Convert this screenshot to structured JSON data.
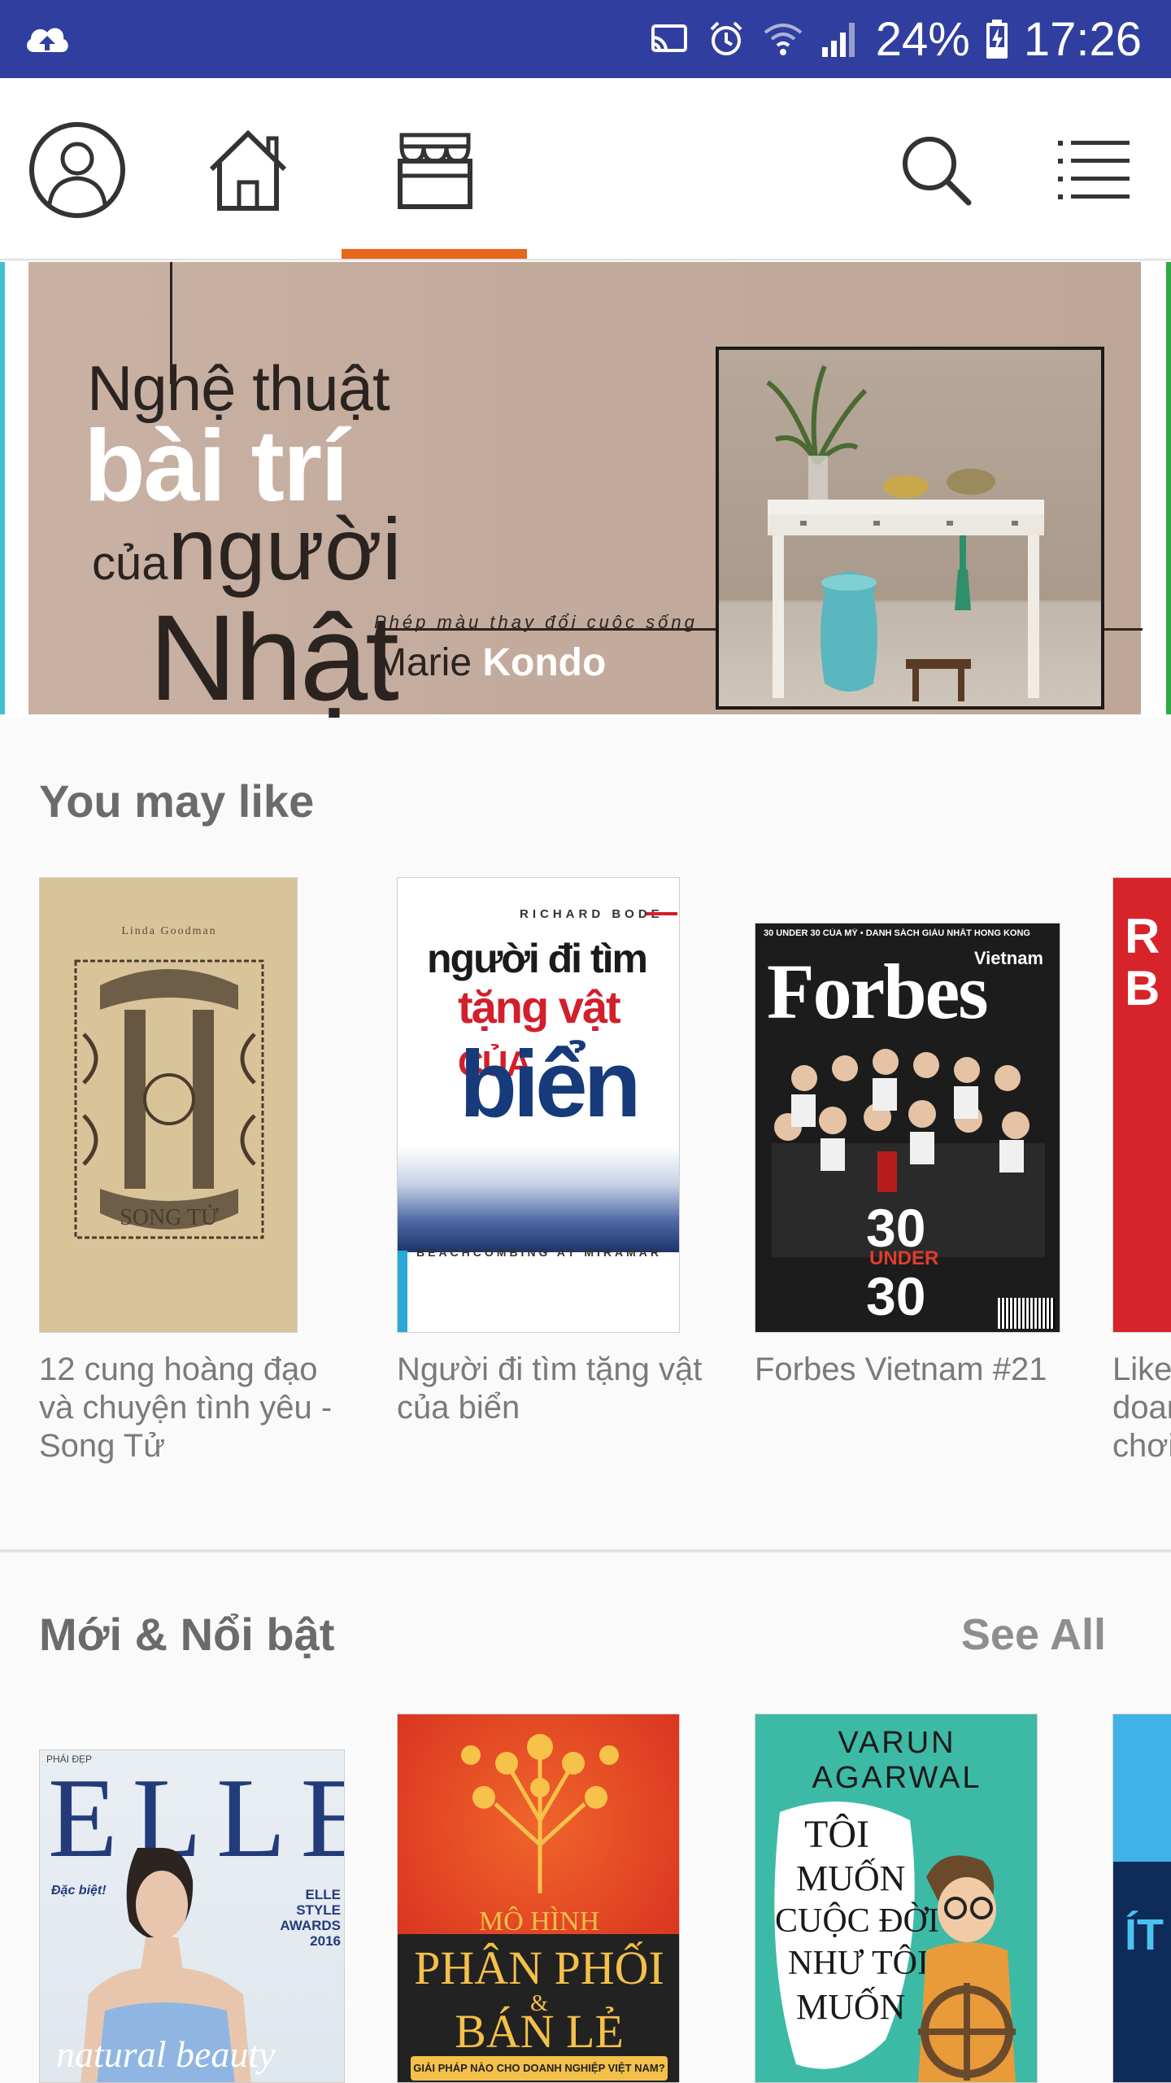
{
  "status_bar": {
    "battery": "24%",
    "time": "17:26",
    "icons": [
      "cloud-upload-icon",
      "cast-icon",
      "alarm-icon",
      "wifi-icon",
      "signal-icon",
      "battery-charging-icon"
    ]
  },
  "nav": {
    "items": [
      "profile-icon",
      "home-icon",
      "store-icon",
      "search-icon",
      "menu-icon"
    ],
    "active": "store",
    "accent": "#e8671a"
  },
  "banner": {
    "line1": "Nghệ thuật",
    "line2": "bài trí",
    "line3_small": "của",
    "line3": "người",
    "line4": "Nhật",
    "subtitle": "Phép màu thay đổi cuộc sống",
    "author_first": "Marie",
    "author_last": "Kondo"
  },
  "you_may_like": {
    "title": "You may like",
    "books": [
      {
        "title": "12 cung hoàng đạo và chuyện tình yêu - Song Tử",
        "cover": {
          "author": "Linda Goodman",
          "name": "SONG TỬ",
          "bg": "#d9c49a"
        }
      },
      {
        "title": "Người đi tìm tặng vật của biển",
        "cover": {
          "author": "RICHARD BODE",
          "t1": "người đi tìm",
          "t2": "tặng vật",
          "t3": "CỦA",
          "t4": "biển",
          "footer": "BEACHCOMBING AT MIRAMAR"
        }
      },
      {
        "title": "Forbes Vietnam #21",
        "cover": {
          "top": "30 UNDER 30 CỦA MỸ • DANH SÁCH GIÀU NHẤT HONG KONG",
          "sub": "Vietnam",
          "brand": "Forbes",
          "n1": "30",
          "mid": "UNDER",
          "n2": "30"
        }
      },
      {
        "title": "Like doan chơi",
        "cover": {
          "text": "R B"
        }
      }
    ]
  },
  "new_featured": {
    "title": "Mới & Nổi bật",
    "see_all": "See All",
    "books": [
      {
        "cover": {
          "brand": "ELLE",
          "tag": "PHÁI ĐẸP",
          "side1": "Đặc biệt!",
          "side2": "ELLE STYLE AWARDS 2016",
          "foot": "natural beauty"
        }
      },
      {
        "cover": {
          "t1": "MÔ HÌNH",
          "t2": "PHÂN PHỐI",
          "t3": "&",
          "t4": "BÁN LẺ",
          "foot": "GIẢI PHÁP NÀO CHO DOANH NGHIỆP VIỆT NAM?"
        }
      },
      {
        "cover": {
          "author": "VARUN AGARWAL",
          "t1": "TÔI",
          "t2": "MUỐN",
          "t3": "CUỘC ĐỜI",
          "t4": "NHƯ TÔI",
          "t5": "MUỐN"
        }
      },
      {
        "cover": {
          "text": "ÍT"
        }
      }
    ]
  }
}
